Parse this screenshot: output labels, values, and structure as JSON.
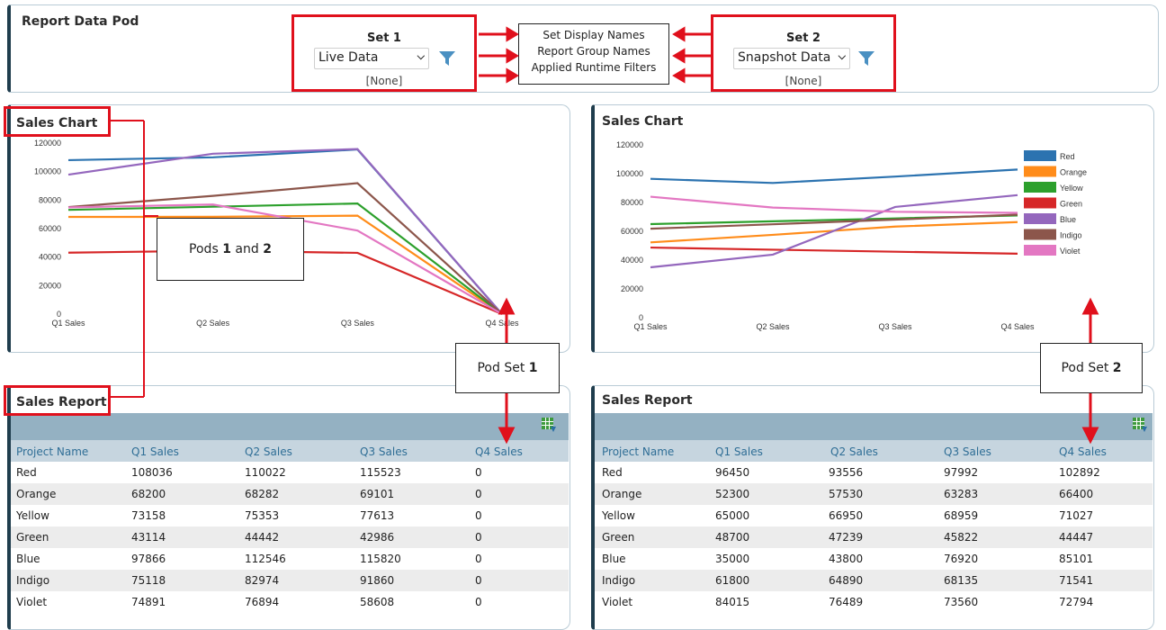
{
  "top_pod": {
    "title": "Report Data Pod",
    "set1": {
      "label": "Set 1",
      "selected": "Live Data",
      "filter": "[None]"
    },
    "set2": {
      "label": "Set 2",
      "selected": "Snapshot Data",
      "filter": "[None]"
    },
    "center_lines": [
      "Set Display Names",
      "Report Group Names",
      "Applied Runtime Filters"
    ]
  },
  "left": {
    "chart_title": "Sales Chart",
    "report_title": "Sales Report",
    "headers": [
      "Project Name",
      "Q1 Sales",
      "Q2 Sales",
      "Q3 Sales",
      "Q4 Sales"
    ],
    "rows": [
      [
        "Red",
        "108036",
        "110022",
        "115523",
        "0"
      ],
      [
        "Orange",
        "68200",
        "68282",
        "69101",
        "0"
      ],
      [
        "Yellow",
        "73158",
        "75353",
        "77613",
        "0"
      ],
      [
        "Green",
        "43114",
        "44442",
        "42986",
        "0"
      ],
      [
        "Blue",
        "97866",
        "112546",
        "115820",
        "0"
      ],
      [
        "Indigo",
        "75118",
        "82974",
        "91860",
        "0"
      ],
      [
        "Violet",
        "74891",
        "76894",
        "58608",
        "0"
      ]
    ]
  },
  "right": {
    "chart_title": "Sales Chart",
    "report_title": "Sales Report",
    "headers": [
      "Project Name",
      "Q1 Sales",
      "Q2 Sales",
      "Q3 Sales",
      "Q4 Sales"
    ],
    "rows": [
      [
        "Red",
        "96450",
        "93556",
        "97992",
        "102892"
      ],
      [
        "Orange",
        "52300",
        "57530",
        "63283",
        "66400"
      ],
      [
        "Yellow",
        "65000",
        "66950",
        "68959",
        "71027"
      ],
      [
        "Green",
        "48700",
        "47239",
        "45822",
        "44447"
      ],
      [
        "Blue",
        "35000",
        "43800",
        "76920",
        "85101"
      ],
      [
        "Indigo",
        "61800",
        "64890",
        "68135",
        "71541"
      ],
      [
        "Violet",
        "84015",
        "76489",
        "73560",
        "72794"
      ]
    ]
  },
  "annotations": {
    "pods": {
      "pre": "Pods ",
      "b1": "1",
      "mid": " and ",
      "b2": "2"
    },
    "set1": {
      "pre": "Pod Set ",
      "b": "1"
    },
    "set2": {
      "pre": "Pod Set ",
      "b": "2"
    }
  },
  "colors": {
    "red_annotation": "#e0101c",
    "pod_border": "#1f3d4d",
    "table_header": "#94b1c2",
    "column_header": "#c6d5df",
    "column_header_text": "#2f6e96"
  },
  "chart_data": [
    {
      "type": "line",
      "categories": [
        "Q1 Sales",
        "Q2 Sales",
        "Q3 Sales",
        "Q4 Sales"
      ],
      "ylim": [
        0,
        120000
      ],
      "yticks": [
        0,
        20000,
        40000,
        60000,
        80000,
        100000,
        120000
      ],
      "legend": false,
      "series": [
        {
          "name": "Red",
          "color": "#2c73b0",
          "values": [
            108036,
            110022,
            115523,
            0
          ]
        },
        {
          "name": "Orange",
          "color": "#ff8c1a",
          "values": [
            68200,
            68282,
            69101,
            0
          ]
        },
        {
          "name": "Yellow",
          "color": "#2ca02c",
          "values": [
            73158,
            75353,
            77613,
            0
          ]
        },
        {
          "name": "Green",
          "color": "#d62728",
          "values": [
            43114,
            44442,
            42986,
            0
          ]
        },
        {
          "name": "Blue",
          "color": "#9467bd",
          "values": [
            97866,
            112546,
            115820,
            0
          ]
        },
        {
          "name": "Indigo",
          "color": "#8c564b",
          "values": [
            75118,
            82974,
            91860,
            0
          ]
        },
        {
          "name": "Violet",
          "color": "#e377c2",
          "values": [
            74891,
            76894,
            58608,
            0
          ]
        }
      ]
    },
    {
      "type": "line",
      "categories": [
        "Q1 Sales",
        "Q2 Sales",
        "Q3 Sales",
        "Q4 Sales"
      ],
      "ylim": [
        0,
        120000
      ],
      "yticks": [
        0,
        20000,
        40000,
        60000,
        80000,
        100000,
        120000
      ],
      "legend": "top-right",
      "series": [
        {
          "name": "Red",
          "color": "#2c73b0",
          "values": [
            96450,
            93556,
            97992,
            102892
          ]
        },
        {
          "name": "Orange",
          "color": "#ff8c1a",
          "values": [
            52300,
            57530,
            63283,
            66400
          ]
        },
        {
          "name": "Yellow",
          "color": "#2ca02c",
          "values": [
            65000,
            66950,
            68959,
            71027
          ]
        },
        {
          "name": "Green",
          "color": "#d62728",
          "values": [
            48700,
            47239,
            45822,
            44447
          ]
        },
        {
          "name": "Blue",
          "color": "#9467bd",
          "values": [
            35000,
            43800,
            76920,
            85101
          ]
        },
        {
          "name": "Indigo",
          "color": "#8c564b",
          "values": [
            61800,
            64890,
            68135,
            71541
          ]
        },
        {
          "name": "Violet",
          "color": "#e377c2",
          "values": [
            84015,
            76489,
            73560,
            72794
          ]
        }
      ]
    }
  ]
}
